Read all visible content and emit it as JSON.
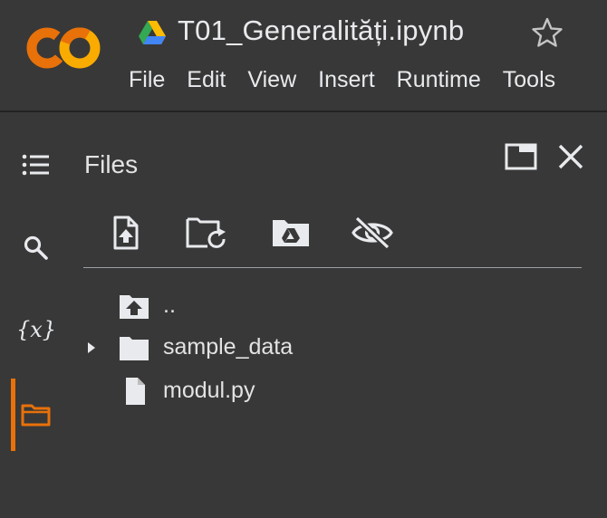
{
  "notebook": {
    "title": "T01_Generalități.ipynb"
  },
  "menu": [
    "File",
    "Edit",
    "View",
    "Insert",
    "Runtime",
    "Tools"
  ],
  "sidebar": {
    "rail_items": [
      {
        "name": "table-of-contents",
        "icon": "list-icon",
        "active": false
      },
      {
        "name": "search",
        "icon": "search-icon",
        "active": false
      },
      {
        "name": "variables",
        "icon": "variables-icon",
        "label": "{x}",
        "active": false
      },
      {
        "name": "files",
        "icon": "folder-icon",
        "active": true
      }
    ],
    "accent_color": "#e8710a"
  },
  "files_panel": {
    "title": "Files",
    "toolbar": [
      {
        "name": "upload-to-session-storage",
        "icon": "file-upload-icon"
      },
      {
        "name": "refresh",
        "icon": "folder-refresh-icon"
      },
      {
        "name": "mount-drive",
        "icon": "drive-folder-icon"
      },
      {
        "name": "show-hidden-files",
        "icon": "eye-off-icon"
      }
    ],
    "tree": [
      {
        "label": "..",
        "icon": "folder-up-icon",
        "expandable": false
      },
      {
        "label": "sample_data",
        "icon": "folder-icon",
        "expandable": true
      },
      {
        "label": "modul.py",
        "icon": "file-icon",
        "expandable": false
      }
    ]
  },
  "colors": {
    "background": "#383838",
    "text": "#e3e3e3",
    "logo_orange": "#f9ab00",
    "logo_dark_orange": "#e8710a"
  }
}
